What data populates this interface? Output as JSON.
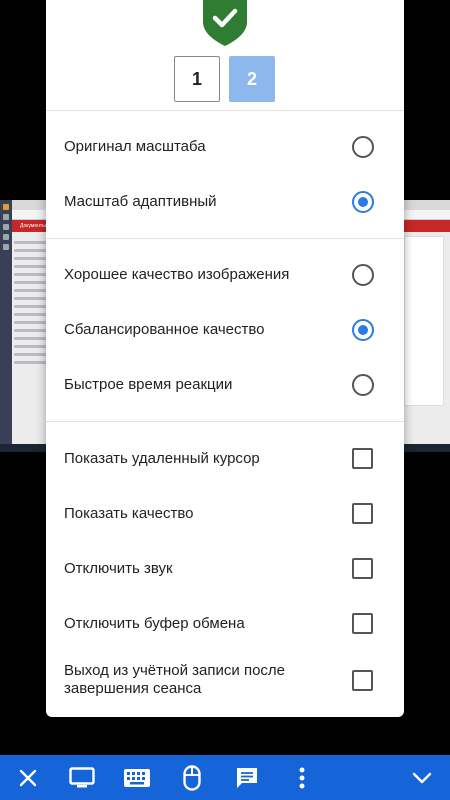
{
  "remote": {
    "red_bar_text": "Документы"
  },
  "monitors": [
    {
      "label": "1",
      "selected": false
    },
    {
      "label": "2",
      "selected": true
    }
  ],
  "scale_options": [
    {
      "label": "Оригинал масштаба",
      "selected": false
    },
    {
      "label": "Масштаб адаптивный",
      "selected": true
    }
  ],
  "quality_options": [
    {
      "label": "Хорошее качество изображения",
      "selected": false
    },
    {
      "label": "Сбалансированное качество",
      "selected": true
    },
    {
      "label": "Быстрое время реакции",
      "selected": false
    }
  ],
  "toggles": [
    {
      "label": "Показать удаленный курсор",
      "checked": false
    },
    {
      "label": "Показать качество",
      "checked": false
    },
    {
      "label": "Отключить звук",
      "checked": false
    },
    {
      "label": "Отключить буфер обмена",
      "checked": false
    },
    {
      "label": "Выход из учётной записи после завершения сеанса",
      "checked": false
    }
  ],
  "toolbar_icons": [
    "close-icon",
    "monitor-icon",
    "keyboard-icon",
    "mouse-icon",
    "chat-icon",
    "more-vert-icon",
    "chevron-down-icon"
  ],
  "colors": {
    "accent": "#2a7be4",
    "toolbar": "#1565d8",
    "shield": "#2e7d32",
    "selected_monitor": "#8cb8ee"
  }
}
